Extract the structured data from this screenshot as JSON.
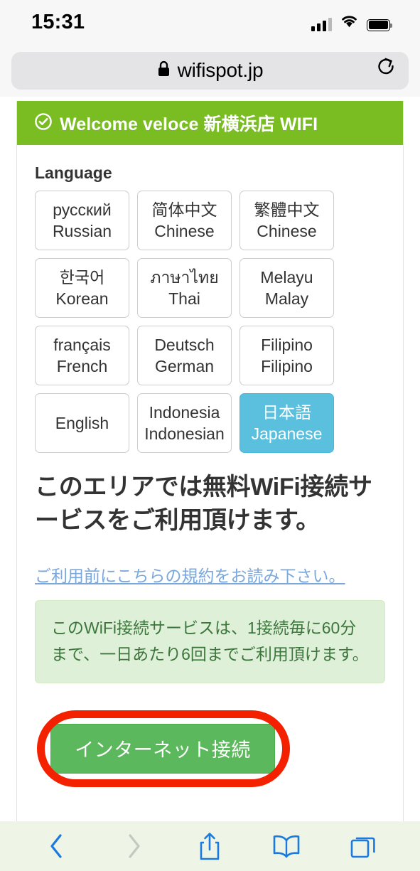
{
  "status_bar": {
    "time": "15:31",
    "signal_icon": "cellular-signal-icon",
    "wifi_icon": "wifi-icon",
    "battery_icon": "battery-icon"
  },
  "browser": {
    "lock_icon": "lock-icon",
    "url": "wifispot.jp",
    "reload_icon": "reload-icon",
    "toolbar": {
      "back_label": "back-icon",
      "forward_label": "forward-icon",
      "share_label": "share-icon",
      "bookmarks_label": "bookmarks-icon",
      "tabs_label": "tabs-icon"
    }
  },
  "page": {
    "header": {
      "check_icon": "check-circle-icon",
      "title": "Welcome veloce 新横浜店 WIFI",
      "background_color": "#79bd23"
    },
    "language_section_label": "Language",
    "languages": [
      {
        "native": "русский",
        "english": "Russian",
        "selected": false
      },
      {
        "native": "简体中文",
        "english": "Chinese",
        "selected": false
      },
      {
        "native": "繁體中文",
        "english": "Chinese",
        "selected": false
      },
      {
        "native": "한국어",
        "english": "Korean",
        "selected": false
      },
      {
        "native": "ภาษาไทย",
        "english": "Thai",
        "selected": false
      },
      {
        "native": "Melayu",
        "english": "Malay",
        "selected": false
      },
      {
        "native": "français",
        "english": "French",
        "selected": false
      },
      {
        "native": "Deutsch",
        "english": "German",
        "selected": false
      },
      {
        "native": "Filipino",
        "english": "Filipino",
        "selected": false
      },
      {
        "native": "English",
        "english": "",
        "selected": false
      },
      {
        "native": "Indonesia",
        "english": "Indonesian",
        "selected": false
      },
      {
        "native": "日本語",
        "english": "Japanese",
        "selected": true
      }
    ],
    "headline": "このエリアでは無料WiFi接続サービスをご利用頂けます。",
    "terms_link": "ご利用前にこちらの規約をお読み下さい。",
    "alert_text": "このWiFi接続サービスは、1接続毎に60分まで、一日あたり6回までご利用頂けます。",
    "connect_button": "インターネット接続",
    "annotation": {
      "shape": "red-ellipse-highlight",
      "color": "#f42100",
      "target": "connect-button"
    },
    "colors": {
      "header_green": "#79bd23",
      "selected_blue": "#5bc0de",
      "button_green": "#5cb85c",
      "alert_bg": "#dff0d8",
      "link_blue": "#7aa8dd"
    }
  }
}
